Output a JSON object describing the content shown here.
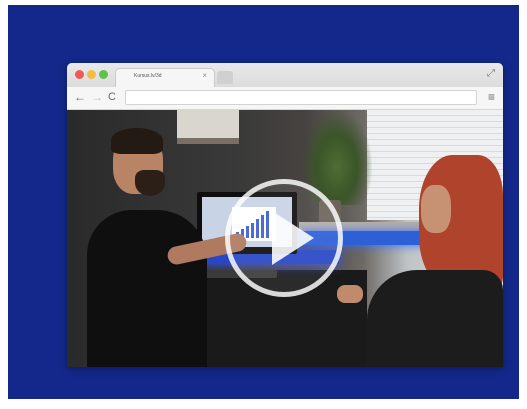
{
  "tab": {
    "title": "Kursus.lv/3d",
    "close_glyph": "×"
  },
  "toolbar": {
    "back_glyph": "←",
    "forward_glyph": "→",
    "reload_glyph": "C",
    "address": "",
    "menu_glyph": "≡"
  },
  "window": {
    "expand_glyph": "⤢"
  },
  "video": {
    "play_icon": "play-icon"
  },
  "colors": {
    "background": "#13288a",
    "play_ring": "#ffffff"
  }
}
